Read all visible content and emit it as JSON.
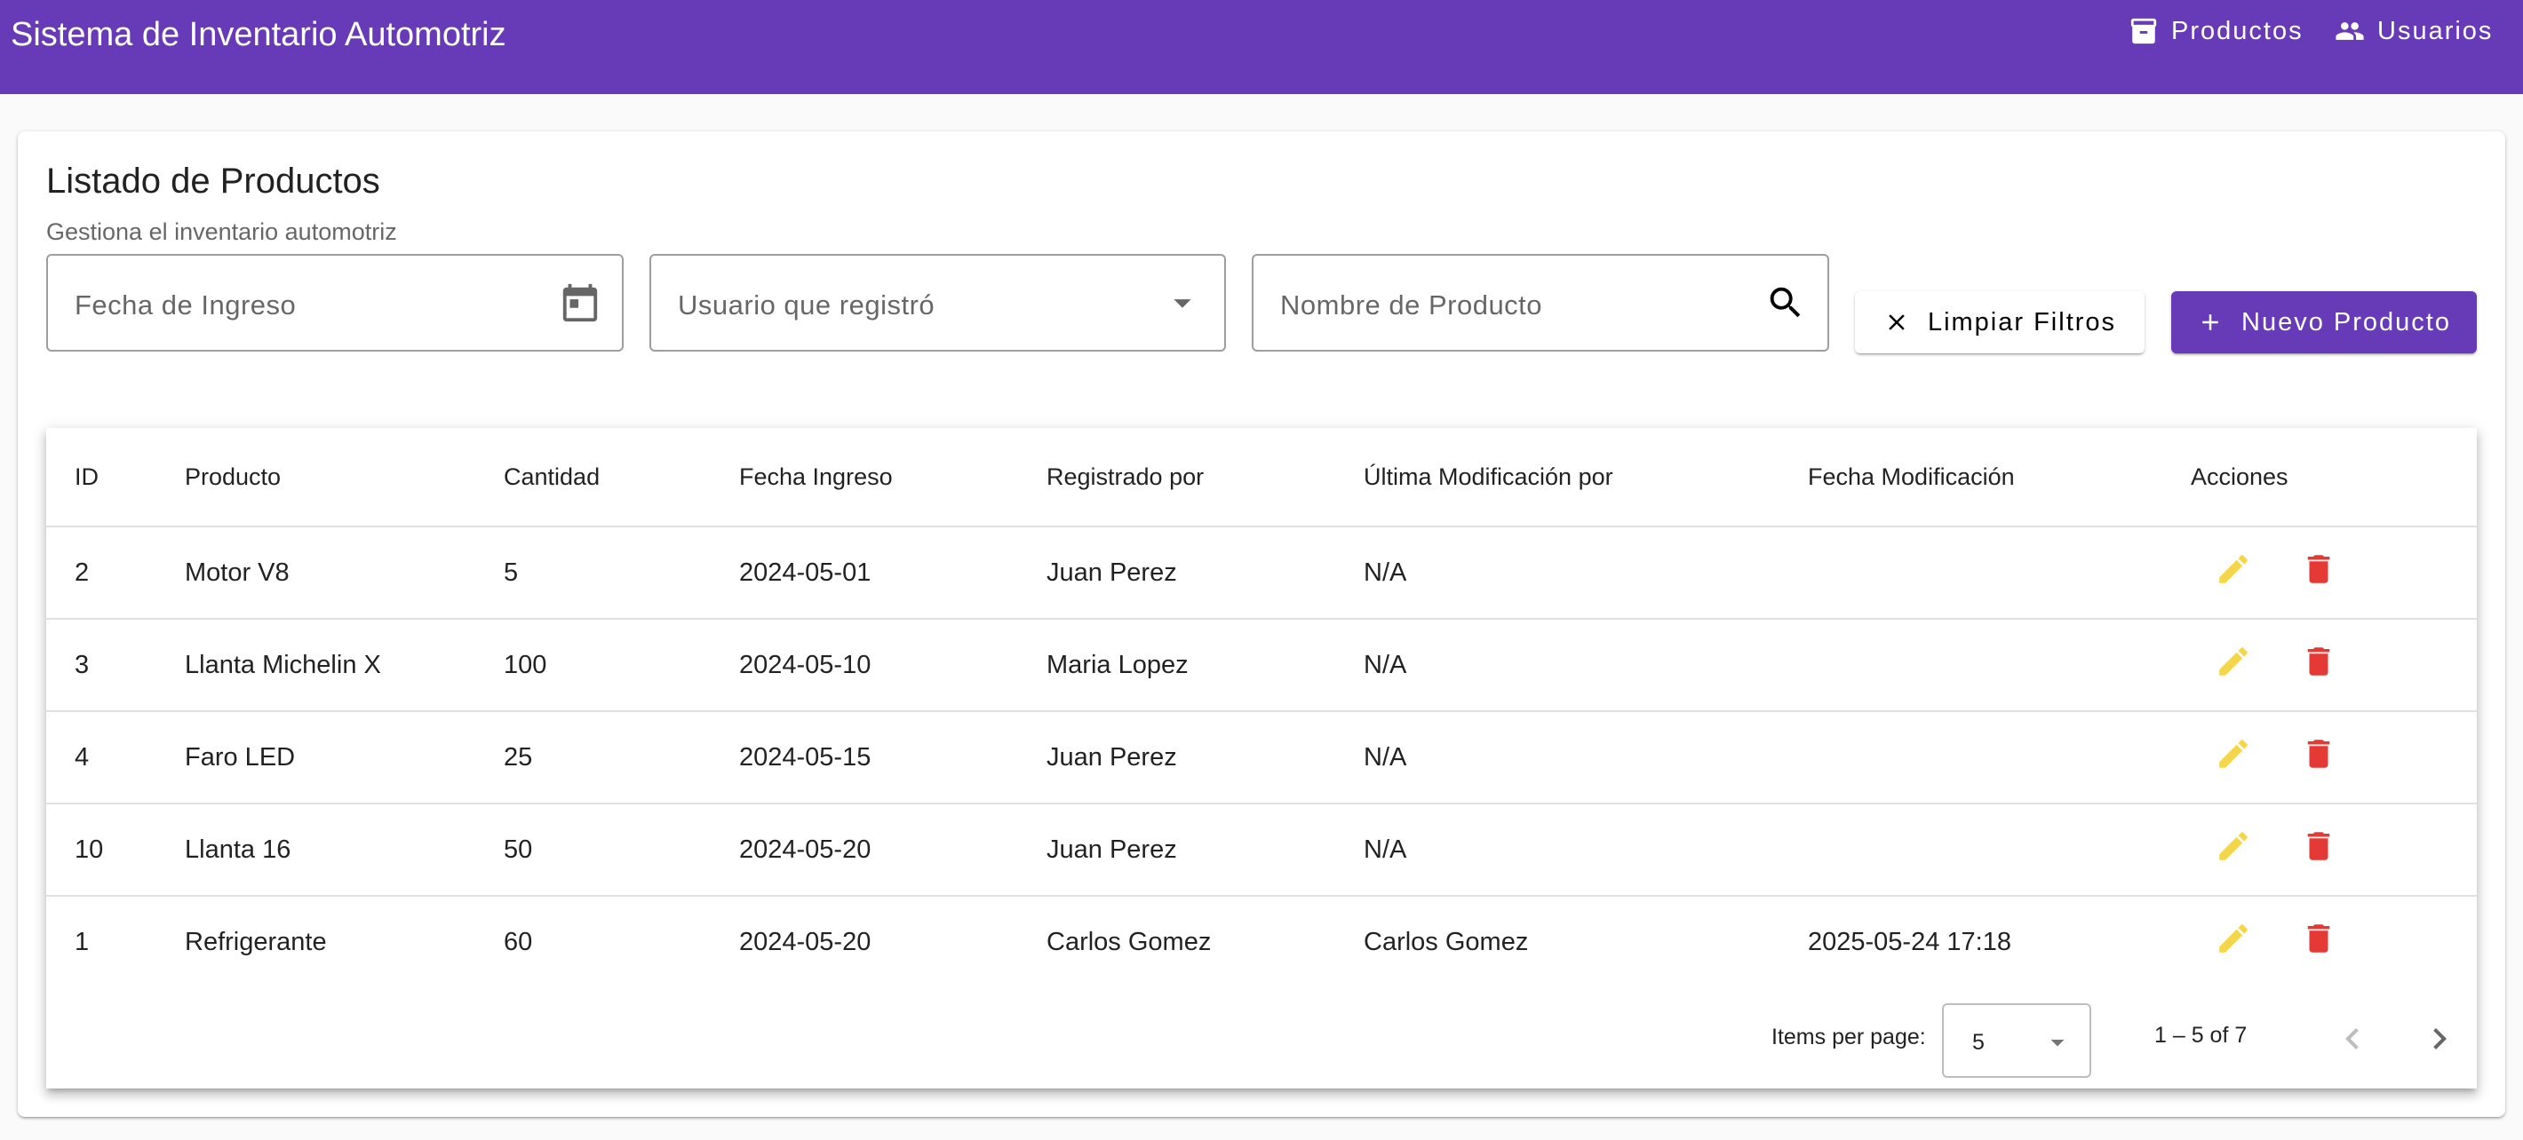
{
  "app": {
    "title": "Sistema de Inventario Automotriz"
  },
  "nav": [
    {
      "label": "Productos",
      "icon": "inventory-box-icon"
    },
    {
      "label": "Usuarios",
      "icon": "people-icon"
    }
  ],
  "card": {
    "title": "Listado de Productos",
    "subtitle": "Gestiona el inventario automotriz"
  },
  "filters": {
    "fecha_ingreso": {
      "placeholder": "Fecha de Ingreso",
      "icon": "calendar-icon"
    },
    "usuario": {
      "placeholder": "Usuario que registró",
      "icon": "dropdown-arrow-icon"
    },
    "nombre": {
      "placeholder": "Nombre de Producto",
      "icon": "search-icon"
    }
  },
  "buttons": {
    "limpiar": "Limpiar Filtros",
    "nuevo": "Nuevo Producto"
  },
  "table": {
    "columns": [
      "ID",
      "Producto",
      "Cantidad",
      "Fecha Ingreso",
      "Registrado por",
      "Última Modificación por",
      "Fecha Modificación",
      "Acciones"
    ],
    "rows": [
      [
        "2",
        "Motor V8",
        "5",
        "2024-05-01",
        "Juan Perez",
        "N/A",
        ""
      ],
      [
        "3",
        "Llanta Michelin X",
        "100",
        "2024-05-10",
        "Maria Lopez",
        "N/A",
        ""
      ],
      [
        "4",
        "Faro LED",
        "25",
        "2024-05-15",
        "Juan Perez",
        "N/A",
        ""
      ],
      [
        "10",
        "Llanta 16",
        "50",
        "2024-05-20",
        "Juan Perez",
        "N/A",
        ""
      ],
      [
        "1",
        "Refrigerante",
        "60",
        "2024-05-20",
        "Carlos Gomez",
        "Carlos Gomez",
        "2025-05-24 17:18"
      ]
    ]
  },
  "paginator": {
    "items_label": "Items per page:",
    "page_size": "5",
    "range": "1 – 5 of 7"
  },
  "colors": {
    "primary": "#673ab7",
    "edit": "#f5d54a",
    "delete": "#e53935"
  }
}
